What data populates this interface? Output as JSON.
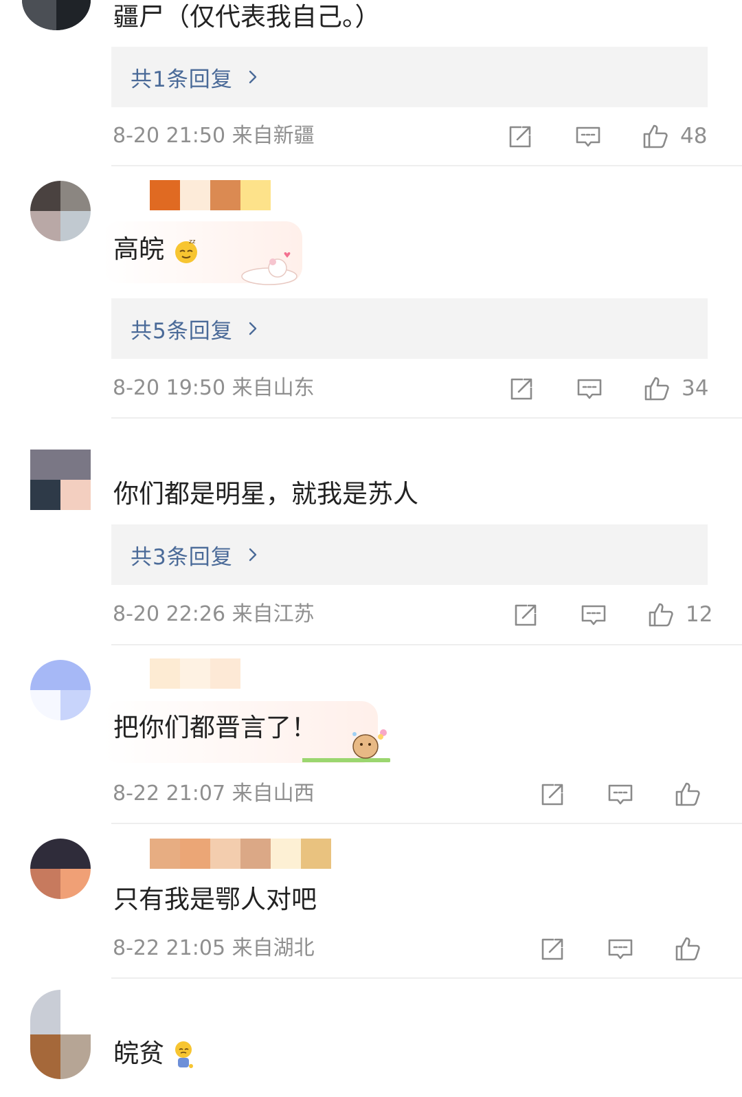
{
  "comments": [
    {
      "text": "疆尸（仅代表我自己。）",
      "replies": "共1条回复",
      "meta": "8-20 21:50  来自新疆",
      "likes": "48"
    },
    {
      "text": "高皖",
      "replies": "共5条回复",
      "meta": "8-20 19:50  来自山东",
      "likes": "34"
    },
    {
      "text": "你们都是明星，就我是苏人",
      "replies": "共3条回复",
      "meta": "8-20 22:26  来自江苏",
      "likes": "12"
    },
    {
      "text": "把你们都晋言了！",
      "meta": "8-22 21:07  来自山西"
    },
    {
      "text": "只有我是鄂人对吧",
      "meta": "8-22 21:05  来自湖北"
    },
    {
      "text": "皖贫"
    }
  ],
  "colors": {
    "reply_link": "#4a6a98",
    "meta_text": "#8f8f8f",
    "reply_bg": "#f3f3f3"
  },
  "icons": [
    "share-icon",
    "comment-icon",
    "like-icon",
    "chevron-right-icon"
  ]
}
